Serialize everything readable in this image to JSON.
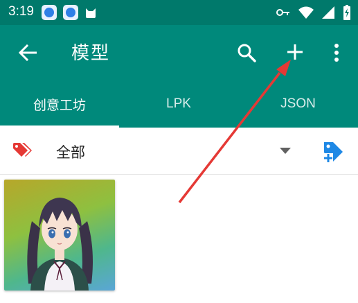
{
  "status_bar": {
    "time": "3:19",
    "icons": [
      "app-badge-icon",
      "app-badge-icon",
      "cat-icon",
      "key-icon",
      "wifi-icon",
      "signal-icon",
      "battery-icon"
    ]
  },
  "app_bar": {
    "title": "模型",
    "actions": [
      "search-icon",
      "add-icon",
      "more-vertical-icon"
    ],
    "color": "#00897b"
  },
  "tabs": [
    {
      "label": "创意工坊",
      "selected": true
    },
    {
      "label": "LPK",
      "selected": false
    },
    {
      "label": "JSON",
      "selected": false
    }
  ],
  "filter": {
    "label": "全部",
    "tag_icon_color": "#e53935",
    "add_tag_icon_color": "#1e88e5"
  },
  "models": [
    {
      "thumbnail": "anime-character-thumbnail"
    }
  ],
  "annotation": {
    "type": "red-arrow",
    "color": "#e53935",
    "points_to": "add-icon"
  }
}
